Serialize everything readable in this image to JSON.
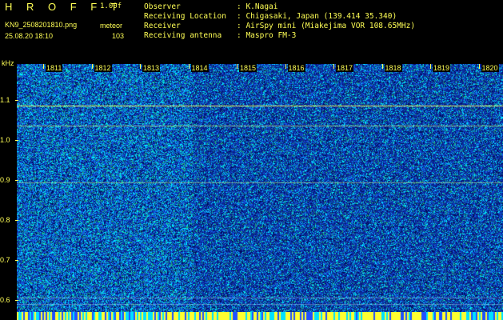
{
  "header": {
    "brand": "H R O F F T",
    "version": "1.00f",
    "filename": "KN9_2508201810.png",
    "mode": "meteor",
    "datetime": "25.08.20 18:10",
    "count": "103"
  },
  "station": [
    {
      "key": "Observer",
      "value": ": K.Nagai"
    },
    {
      "key": "Receiving Location",
      "value": ": Chigasaki, Japan (139.414 35.340)"
    },
    {
      "key": "Receiver",
      "value": ": AirSpy mini (Miakejima VOR 108.65MHz)"
    },
    {
      "key": "Receiving antenna",
      "value": ": Maspro FM-3"
    }
  ],
  "spectrogram": {
    "y_unit": "kHz",
    "y_ticks": [
      "1.1",
      "1.0",
      "0.9",
      "0.8",
      "0.7",
      "0.6"
    ],
    "x_ticks": [
      "1811",
      "1812",
      "1813",
      "1814",
      "1815",
      "1816",
      "1817",
      "1818",
      "1819",
      "1820"
    ],
    "colors": {
      "background": "#1030a8",
      "noise_hi": "#00e0ff",
      "noise_mid": "#20c080",
      "signal": "#ffff40",
      "frame": "#000000"
    }
  }
}
